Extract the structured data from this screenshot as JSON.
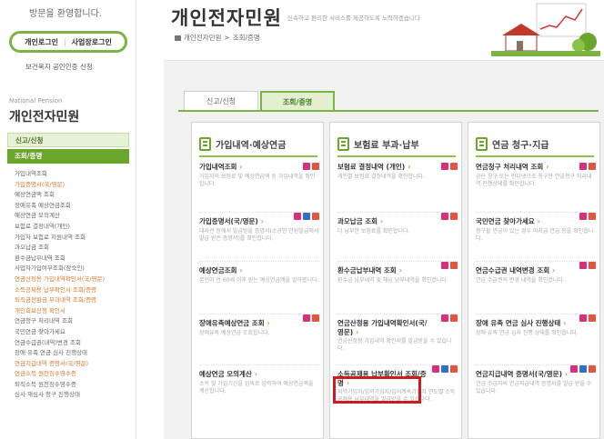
{
  "sidebar": {
    "welcome": "방문을 환영합니다.",
    "login_personal": "개인로그인",
    "login_business": "사업장로그인",
    "cert_link": "보건복지 공인인증 신청",
    "subtitle_en": "National Pension",
    "title": "개인전자민원",
    "tabs": [
      "신고/신청",
      "조회/증명"
    ],
    "items": [
      {
        "label": "가입내역조회",
        "hl": false
      },
      {
        "label": "가입증명서(국/영문)",
        "hl": true
      },
      {
        "label": "예상연금액 조회",
        "hl": false
      },
      {
        "label": "장애유족 예상연금조회",
        "hl": false
      },
      {
        "label": "예상연금 모의계산",
        "hl": false
      },
      {
        "label": "보험료 결정내역(개인)",
        "hl": false
      },
      {
        "label": "가입자 보험료 지원내역 조회",
        "hl": false
      },
      {
        "label": "과오납금 조회",
        "hl": false
      },
      {
        "label": "환수금납부내역 조회",
        "hl": false
      },
      {
        "label": "사업자가입여부조회(잠숙인)",
        "hl": false
      },
      {
        "label": "연금산정용 가입내역확인서(국/영문)",
        "hl": true
      },
      {
        "label": "소득공제용 납부확인서 조회/증명",
        "hl": true
      },
      {
        "label": "퇴직금전환금 부과내역 조회/증명",
        "hl": true
      },
      {
        "label": "개인회보신청 확인서",
        "hl": true
      },
      {
        "label": "연금청구 처리내역 조회",
        "hl": false
      },
      {
        "label": "국민연금 찾아가세요",
        "hl": false
      },
      {
        "label": "연금수급권(내역)변경 조회",
        "hl": false
      },
      {
        "label": "장애·유족 연금 심사 진행상태",
        "hl": false
      },
      {
        "label": "연금지급내역 증명서(국/영문)",
        "hl": true
      },
      {
        "label": "연금소득 원천징수영수증",
        "hl": true
      },
      {
        "label": "퇴직소득 원천징수영수증",
        "hl": false
      },
      {
        "label": "심사·재심사 청구 진행상태",
        "hl": false
      }
    ]
  },
  "header": {
    "title": "개인전자민원",
    "subtitle": "신속하고 편리한 서비스를 제공하도록 노력하겠습니다",
    "breadcrumb": [
      "개인전자민원",
      "조회/증명"
    ]
  },
  "main": {
    "tabs": [
      "신고/신청",
      "조회/증명"
    ],
    "columns": [
      {
        "title": "가입내역·예상연금",
        "items": [
          {
            "title": "가입내역조회",
            "desc": "가입자의 보험료 및 예상연금액 등 가입내역을 확인합니다.",
            "badges": [
              "doc",
              "pdf"
            ]
          },
          {
            "title": "가입증명서(국/영문)",
            "desc": "대사관 등에서 발급받을 증명서(소공인 민원발급에서 발급 받은 증명서)를 확인합니다.",
            "badges": [
              "doc",
              "mob",
              "pdf"
            ]
          },
          {
            "title": "예상연금조회",
            "desc": "본인이 만 60세 이후 받는 예상연금액을 알아봅니다.",
            "badges": []
          },
          {
            "title": "장애유족예상연금 조회",
            "desc": "장애유족 예상연금 조회합니다.",
            "badges": [
              "doc",
              "pdf"
            ]
          },
          {
            "title": "예상연금 모의계산",
            "desc": "소득 및 가입기간을 임의로 입력하여 예상연금액을 계산합니다.",
            "badges": []
          }
        ]
      },
      {
        "title": "보험료 부과·납부",
        "items": [
          {
            "title": "보험료 결정내역 (개인)",
            "desc": "개인별 보험료 결정내역을 확인합니다.",
            "badges": [
              "doc",
              "pdf"
            ]
          },
          {
            "title": "과오납금 조회",
            "desc": "더 납부한 보험료를 확인합니다.",
            "badges": [
              "doc",
              "pdf"
            ]
          },
          {
            "title": "환수금납부내역 조회",
            "desc": "환수금 납부내역 및 체납 납부내역을 확인합니다.",
            "badges": [
              "doc",
              "pdf"
            ]
          },
          {
            "title": "연금산정용 가입내역확인서(국/영문)",
            "desc": "연금산정용 가입내역 확인서를 발급받을 수 있습니다.",
            "badges": [
              "doc",
              "pdf"
            ]
          },
          {
            "title": "소득공제용 납부확인서 조회/증명",
            "desc": "지역가입자/임의가입자/임의계속가입자 연도별 소득공제용 납부내역을 발급받을 수 있습니다.",
            "badges": [
              "doc",
              "mob",
              "pdf"
            ]
          }
        ]
      },
      {
        "title": "연금 청구·지급",
        "items": [
          {
            "title": "연금청구 처리내역 조회",
            "desc": "공단 창구 또는 인터넷으로 청구한 연금청구 처리내역 진행상태를 확인합니다.",
            "badges": [
              "doc",
              "pdf"
            ]
          },
          {
            "title": "국민연금 찾아가세요",
            "desc": "청구할 연금이 있는 경우 미지급 연금 등을 확인합니다.",
            "badges": [
              "doc",
              "pdf"
            ]
          },
          {
            "title": "연금수급권 내역변경 조회",
            "desc": "연금 수급권의 변경 내역을 확인합니다.",
            "badges": [
              "doc",
              "pdf"
            ]
          },
          {
            "title": "장애 유족 연금 심사 진행상태",
            "desc": "장애·유족 연금 심사 진행 상태를 확인합니다.",
            "badges": [
              "doc",
              "pdf"
            ]
          },
          {
            "title": "연금지급내역 증명서(국/영문)",
            "desc": "연금 수급자의 연금지급내역 증명서를 발급 받을 수 있습니다.",
            "badges": [
              "doc",
              "mob",
              "pdf"
            ]
          }
        ]
      }
    ]
  },
  "colors": {
    "accent": "#7cb342",
    "accent_dark": "#6aa52c",
    "highlight_box": "#cf1a20",
    "link_orange": "#e08a1e"
  }
}
